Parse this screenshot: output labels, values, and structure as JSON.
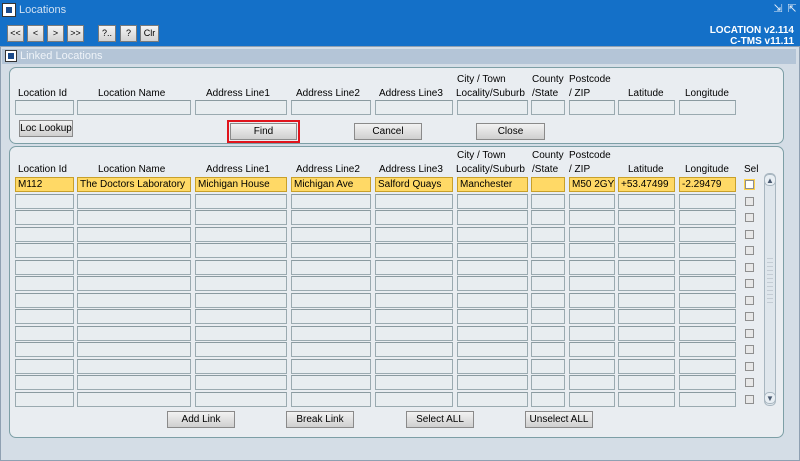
{
  "window": {
    "title": "Locations",
    "controls": [
      "⇲",
      "⇱"
    ]
  },
  "toolbar": {
    "buttons": [
      "<<",
      "<",
      ">",
      ">>",
      "?..",
      "?",
      "Clr"
    ],
    "version_line1": "LOCATION v2.114",
    "version_line2": "C-TMS v11.11"
  },
  "subwindow": {
    "title": "Linked Locations"
  },
  "search": {
    "headers": {
      "location_id": "Location Id",
      "location_name": "Location Name",
      "address1": "Address Line1",
      "address2": "Address Line2",
      "address3": "Address Line3",
      "city_l1": "City / Town",
      "city_l2": "Locality/Suburb",
      "county_l1": "County",
      "county_l2": "/State",
      "postcode_l1": "Postcode",
      "postcode_l2": "/ ZIP",
      "latitude": "Latitude",
      "longitude": "Longitude"
    },
    "buttons": {
      "loc_lookup": "Loc Lookup",
      "find": "Find",
      "cancel": "Cancel",
      "close": "Close"
    }
  },
  "results": {
    "headers": {
      "location_id": "Location Id",
      "location_name": "Location Name",
      "address1": "Address Line1",
      "address2": "Address Line2",
      "address3": "Address Line3",
      "city_l1": "City / Town",
      "city_l2": "Locality/Suburb",
      "county_l1": "County",
      "county_l2": "/State",
      "postcode_l1": "Postcode",
      "postcode_l2": "/ ZIP",
      "latitude": "Latitude",
      "longitude": "Longitude",
      "sel": "Sel"
    },
    "rows": [
      [
        "M112",
        "The Doctors Laboratory",
        "Michigan House",
        "Michigan Ave",
        "Salford Quays",
        "Manchester",
        "",
        "M50 2GY",
        "+53.47499",
        "-2.29479"
      ]
    ],
    "buttons": {
      "add_link": "Add Link",
      "break_link": "Break Link",
      "select_all": "Select ALL",
      "unselect_all": "Unselect ALL"
    }
  },
  "scrollbar": {
    "up": "▲",
    "down": "▼"
  }
}
